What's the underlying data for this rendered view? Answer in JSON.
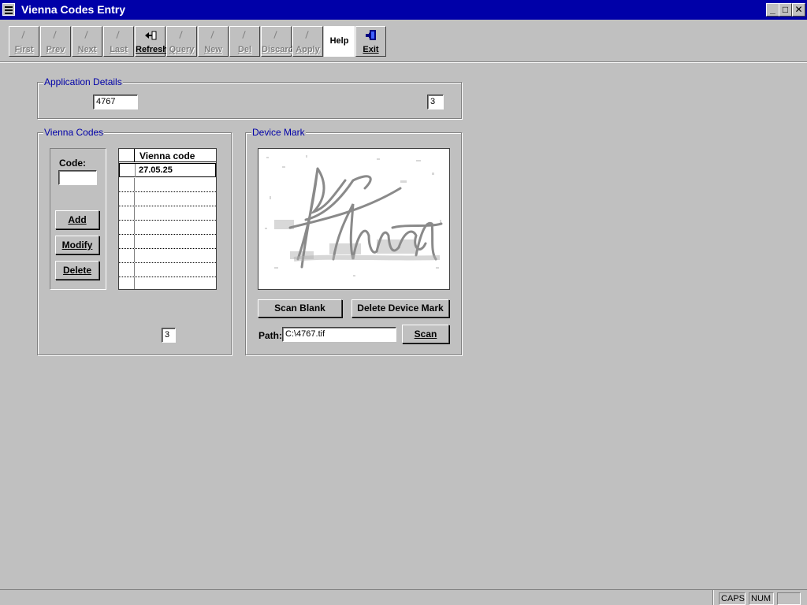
{
  "window": {
    "title": "Vienna Codes Entry",
    "controls": {
      "minimize": "_",
      "maximize": "□",
      "close": "✕"
    }
  },
  "toolbar": {
    "first": "First",
    "prev": "Prev",
    "next": "Next",
    "last": "Last",
    "refresh": "Refresh",
    "query": "Query",
    "new": "New",
    "del": "Del",
    "discard": "Discard",
    "apply": "Apply",
    "help": "Help",
    "exit": "Exit"
  },
  "application_details": {
    "legend": "Application Details",
    "application_number": "4767",
    "count": "3"
  },
  "vienna_codes": {
    "legend": "Vienna Codes",
    "code_label": "Code:",
    "code_value": "",
    "add_label": "Add",
    "modify_label": "Modify",
    "delete_label": "Delete",
    "column_header": "Vienna code",
    "rows": [
      "27.05.25",
      "",
      "",
      "",
      "",
      "",
      "",
      "",
      ""
    ],
    "count": "3"
  },
  "device_mark": {
    "legend": "Device Mark",
    "scan_blank_label": "Scan Blank",
    "delete_label": "Delete Device Mark",
    "path_label": "Path:",
    "path_value": "C:\\4767.tif",
    "scan_label": "Scan"
  },
  "statusbar": {
    "caps": "CAPS",
    "num": "NUM",
    "extra": ""
  }
}
